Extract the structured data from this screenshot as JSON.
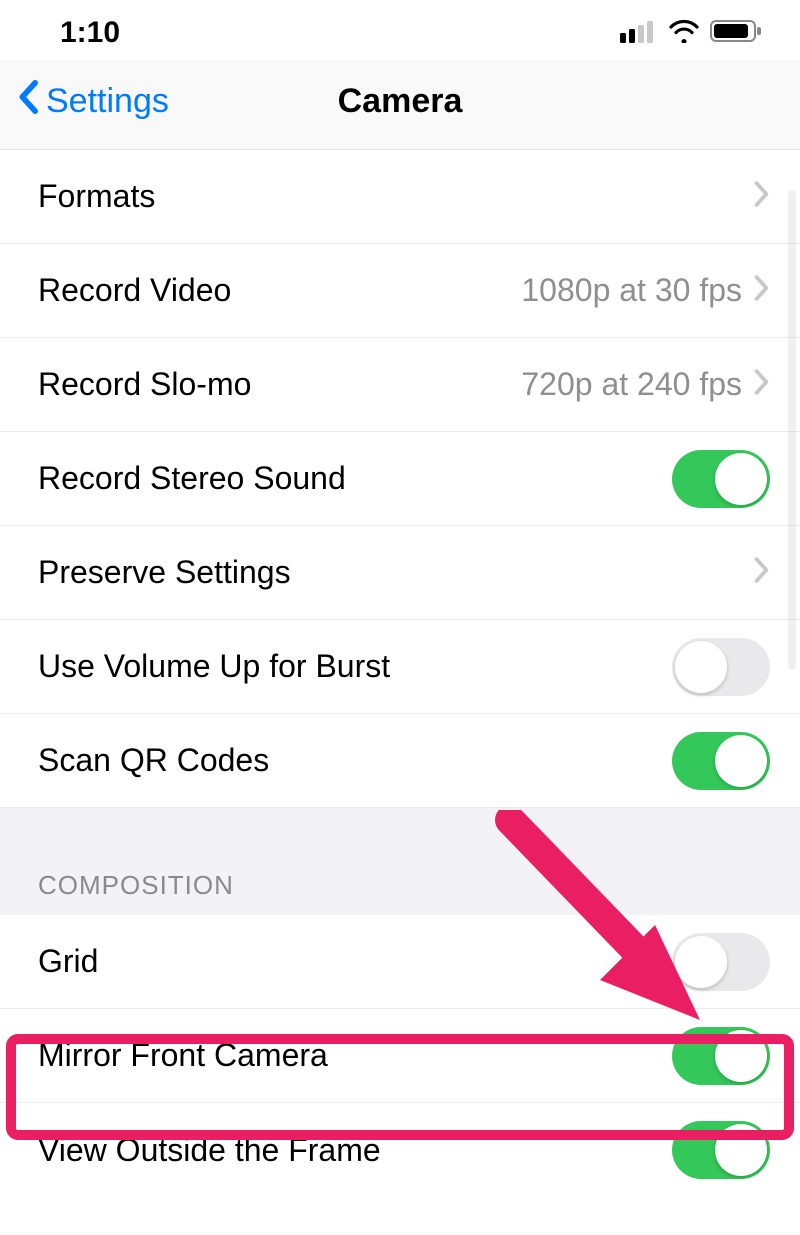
{
  "status_bar": {
    "time": "1:10"
  },
  "nav": {
    "back_label": "Settings",
    "title": "Camera"
  },
  "section1": {
    "formats": {
      "label": "Formats"
    },
    "record_video": {
      "label": "Record Video",
      "value": "1080p at 30 fps"
    },
    "record_slomo": {
      "label": "Record Slo-mo",
      "value": "720p at 240 fps"
    },
    "stereo_sound": {
      "label": "Record Stereo Sound",
      "on": true
    },
    "preserve": {
      "label": "Preserve Settings"
    },
    "volume_burst": {
      "label": "Use Volume Up for Burst",
      "on": false
    },
    "scan_qr": {
      "label": "Scan QR Codes",
      "on": true
    }
  },
  "section2": {
    "header": "COMPOSITION",
    "grid": {
      "label": "Grid",
      "on": false
    },
    "mirror": {
      "label": "Mirror Front Camera",
      "on": true
    },
    "view_outside": {
      "label": "View Outside the Frame",
      "on": true
    }
  },
  "colors": {
    "tint": "#007aff",
    "toggle_on": "#34c759",
    "toggle_off": "#e9e9eb",
    "highlight": "#e91e63"
  }
}
